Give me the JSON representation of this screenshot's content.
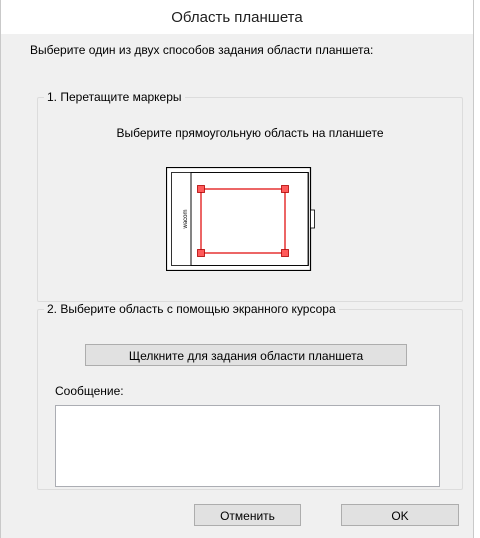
{
  "window": {
    "title": "Область планшета"
  },
  "instruction": "Выберите один из двух способов задания области планшета:",
  "drag_group": {
    "legend": "1. Перетащите маркеры",
    "subheading": "Выберите прямоугольную область на планшете",
    "tablet_logo": "wacom"
  },
  "cursor_group": {
    "legend": "2. Выберите область с помощью экранного курсора",
    "click_button_label": "Щелкните для задания области планшета",
    "message_label": "Сообщение:",
    "message_value": ""
  },
  "buttons": {
    "cancel_label": "Отменить",
    "ok_label": "OK"
  },
  "colors": {
    "selection": "#e00000",
    "marker_fill": "#ff5a5a"
  }
}
